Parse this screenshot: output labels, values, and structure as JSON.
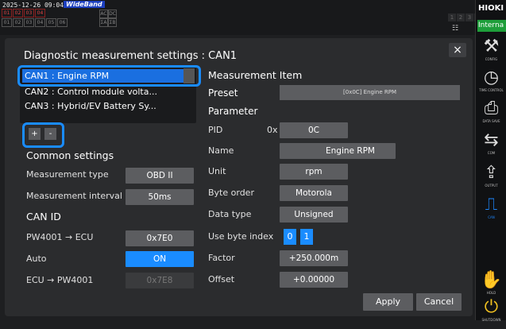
{
  "status": {
    "timestamp": "2025-12-26 09:04:22",
    "band": "WideBand",
    "channels_row1": [
      "01",
      "02",
      "03",
      "04"
    ],
    "channels_row2": [
      "01",
      "02",
      "03",
      "04",
      "05",
      "06"
    ],
    "small_boxes": [
      "AC",
      "DC",
      "ΣA",
      "ΣB"
    ],
    "nums": [
      "1",
      "2",
      "3",
      "4"
    ]
  },
  "sidebar": {
    "brand": "HIOKI",
    "mode": "Interna",
    "buttons": [
      {
        "label": "CONFIG",
        "icon": "tools-icon"
      },
      {
        "label": "TIME CONTROL",
        "icon": "timer-icon"
      },
      {
        "label": "DATA SAVE",
        "icon": "save-icon"
      },
      {
        "label": "COM",
        "icon": "com-icon"
      },
      {
        "label": "OUTPUT",
        "icon": "output-icon"
      },
      {
        "label": "CAN",
        "icon": "can-icon"
      },
      {
        "label": "HOLD",
        "icon": "hold-icon"
      },
      {
        "label": "SHUTDOWN",
        "icon": "power-icon"
      }
    ]
  },
  "dialog": {
    "title": "Diagnostic measurement settings : CAN1",
    "close": "×",
    "list": [
      "CAN1 : Engine RPM",
      "CAN2 : Control module volta...",
      "CAN3 : Hybrid/EV Battery Sy..."
    ],
    "plus": "+",
    "minus": "-",
    "common": {
      "heading": "Common settings",
      "type_label": "Measurement type",
      "type_value": "OBD II",
      "interval_label": "Measurement interval",
      "interval_value": "50ms"
    },
    "canid": {
      "heading": "CAN ID",
      "tx_label": "PW4001 → ECU",
      "tx_value": "0x7E0",
      "auto_label": "Auto",
      "auto_value": "ON",
      "rx_label": "ECU → PW4001",
      "rx_value": "0x7E8"
    },
    "item": {
      "heading": "Measurement Item",
      "preset_label": "Preset",
      "preset_value": "[0x0C] Engine RPM",
      "parameter_heading": "Parameter",
      "pid_label": "PID",
      "pid_prefix": "0x",
      "pid_value": "0C",
      "name_label": "Name",
      "name_value": "Engine RPM",
      "unit_label": "Unit",
      "unit_value": "rpm",
      "order_label": "Byte order",
      "order_value": "Motorola",
      "dtype_label": "Data type",
      "dtype_value": "Unsigned",
      "index_label": "Use byte index",
      "index_values": [
        "0",
        "1"
      ],
      "factor_label": "Factor",
      "factor_value": "+250.000m",
      "offset_label": "Offset",
      "offset_value": "+0.00000"
    },
    "apply": "Apply",
    "cancel": "Cancel"
  }
}
